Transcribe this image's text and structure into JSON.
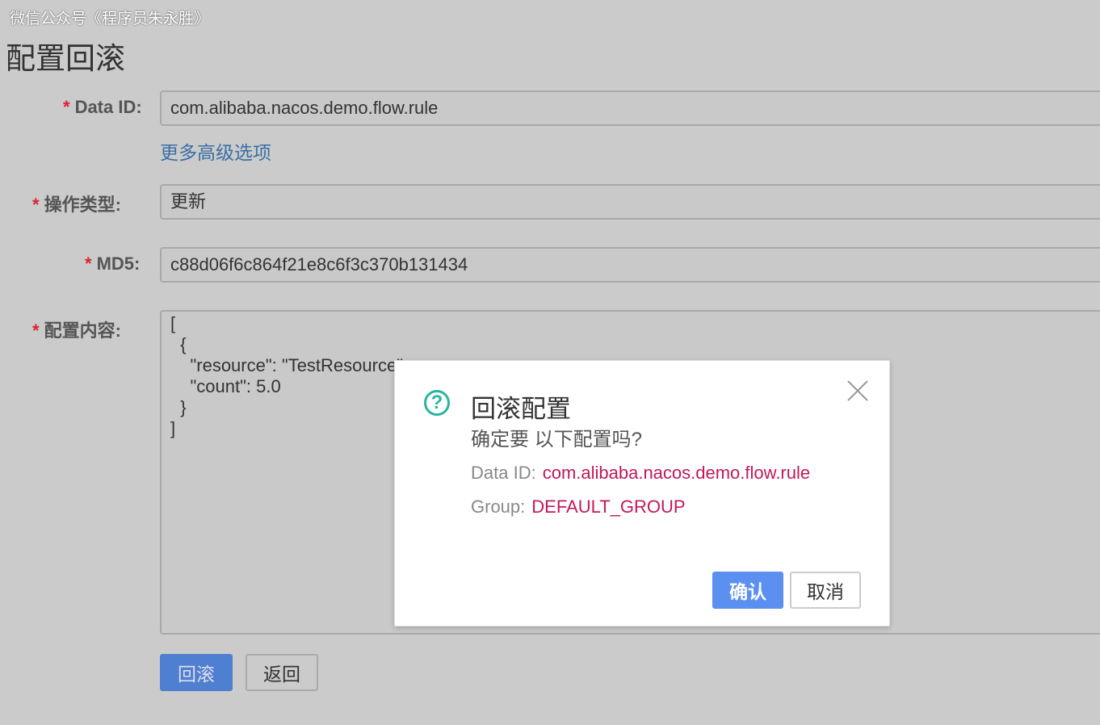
{
  "watermark": "微信公众号《程序员朱永胜》",
  "page_title": "配置回滚",
  "form": {
    "data_id": {
      "label": "Data ID:",
      "value": "com.alibaba.nacos.demo.flow.rule"
    },
    "advanced_link": "更多高级选项",
    "op_type": {
      "label": "操作类型:",
      "value": "更新"
    },
    "md5": {
      "label": "MD5:",
      "value": "c88d06f6c864f21e8c6f3c370b131434"
    },
    "content": {
      "label": "配置内容:",
      "value": "[\n  {\n    \"resource\": \"TestResource\",\n    \"count\": 5.0\n  }\n]"
    },
    "required_mark": "*"
  },
  "buttons": {
    "rollback": "回滚",
    "back": "返回"
  },
  "dialog": {
    "title": "回滚配置",
    "message": "确定要 以下配置吗?",
    "data_id_label": "Data ID:",
    "data_id_value": "com.alibaba.nacos.demo.flow.rule",
    "group_label": "Group:",
    "group_value": "DEFAULT_GROUP",
    "confirm": "确认",
    "cancel": "取消"
  }
}
